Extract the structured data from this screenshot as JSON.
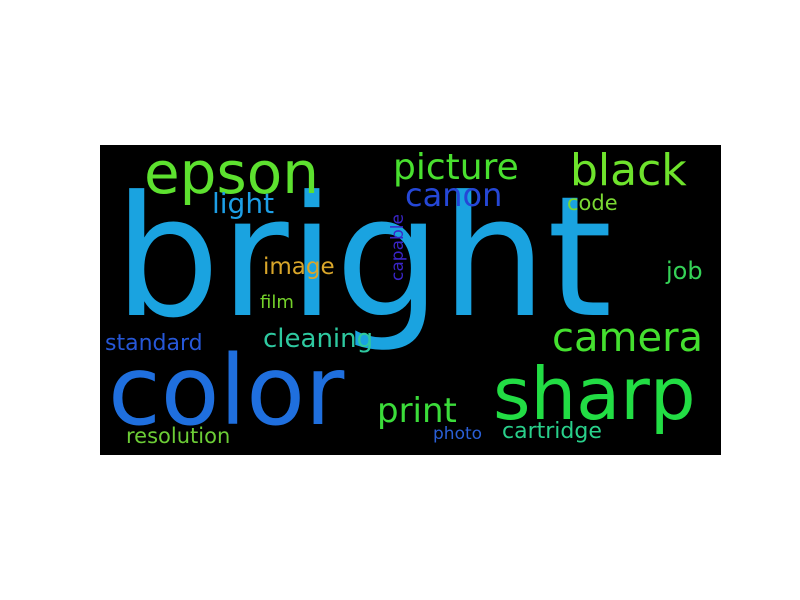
{
  "word_cloud": {
    "background": "#000000",
    "words": [
      {
        "id": "bright",
        "text": "bright",
        "color": "#1aa3e0"
      },
      {
        "id": "color",
        "text": "color",
        "color": "#1f6fde"
      },
      {
        "id": "sharp",
        "text": "sharp",
        "color": "#22dd44"
      },
      {
        "id": "epson",
        "text": "epson",
        "color": "#5de12f"
      },
      {
        "id": "black",
        "text": "black",
        "color": "#6ee32c"
      },
      {
        "id": "picture",
        "text": "picture",
        "color": "#49e02f"
      },
      {
        "id": "camera",
        "text": "camera",
        "color": "#44e02f"
      },
      {
        "id": "canon",
        "text": "canon",
        "color": "#2547d6"
      },
      {
        "id": "light",
        "text": "light",
        "color": "#1d9fe6"
      },
      {
        "id": "print",
        "text": "print",
        "color": "#3bdc3a"
      },
      {
        "id": "code",
        "text": "code",
        "color": "#7ad933"
      },
      {
        "id": "image",
        "text": "image",
        "color": "#d9a62a"
      },
      {
        "id": "job",
        "text": "job",
        "color": "#35d257"
      },
      {
        "id": "capable",
        "text": "capable",
        "color": "#3a25c8"
      },
      {
        "id": "film",
        "text": "film",
        "color": "#74d12a"
      },
      {
        "id": "standard",
        "text": "standard",
        "color": "#2657d8"
      },
      {
        "id": "cleaning",
        "text": "cleaning",
        "color": "#2ec9a0"
      },
      {
        "id": "resolution",
        "text": "resolution",
        "color": "#6ccd36"
      },
      {
        "id": "photo",
        "text": "photo",
        "color": "#2a5fd6"
      },
      {
        "id": "cartridge",
        "text": "cartridge",
        "color": "#29d08b"
      }
    ]
  }
}
